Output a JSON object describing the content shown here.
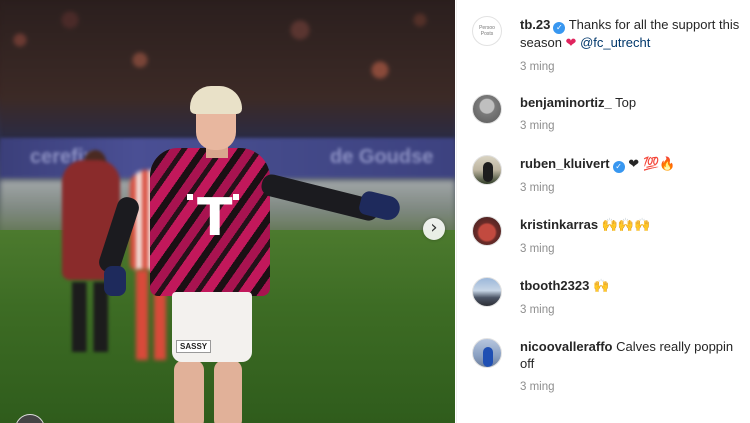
{
  "photo": {
    "board_text_1": "cerefix",
    "board_text_2": "de Goudse",
    "shirt_logo": "T",
    "sponsor": "SASSY",
    "next_icon": "chevron-right-icon"
  },
  "post": {
    "author_avatar_text": "Persoo Posts",
    "author": "tb.23",
    "verified": true,
    "caption": "Thanks for all the support this season",
    "caption_heart": "❤",
    "mention": "@fc_utrecht",
    "time": "3 ming"
  },
  "comments": [
    {
      "user": "benjaminortiz_",
      "verified": false,
      "text": "Top",
      "time": "3 ming"
    },
    {
      "user": "ruben_kluivert",
      "verified": true,
      "text": "❤ 💯🔥",
      "time": "3 ming"
    },
    {
      "user": "kristinkarras",
      "verified": false,
      "text": "🙌🙌🙌",
      "time": "3 ming"
    },
    {
      "user": "tbooth2323",
      "verified": false,
      "text": "🙌",
      "time": "3 ming"
    },
    {
      "user": "nicoovalleraffo",
      "verified": false,
      "text": "Calves really poppin off",
      "time": "3 ming"
    }
  ],
  "colors": {
    "verified": "#3897f0",
    "mention": "#00376b",
    "heart": "#e0245e",
    "time": "#8e8e8e"
  }
}
